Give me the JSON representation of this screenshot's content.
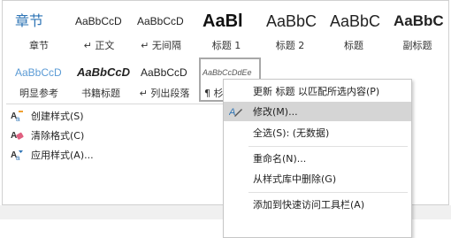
{
  "gallery": {
    "row1": [
      {
        "preview": "章节",
        "caption": "章节"
      },
      {
        "preview": "AaBbCcD",
        "caption": "↵ 正文"
      },
      {
        "preview": "AaBbCcD",
        "caption": "↵ 无间隔"
      },
      {
        "preview": "AaBl",
        "caption": "标题 1"
      },
      {
        "preview": "AaBbC",
        "caption": "标题 2"
      },
      {
        "preview": "AaBbC",
        "caption": "标题"
      },
      {
        "preview": "AaBbC",
        "caption": "副标题"
      }
    ],
    "row2": [
      {
        "preview": "AaBbCcD",
        "caption": "明显参考"
      },
      {
        "preview": "AaBbCcD",
        "caption": "书籍标题"
      },
      {
        "preview": "AaBbCcD",
        "caption": "↵ 列出段落"
      },
      {
        "preview": "AaBbCcDdEe",
        "caption": "¶ 杉"
      }
    ]
  },
  "actions": [
    {
      "label": "创建样式(S)",
      "icon": "create-style-icon"
    },
    {
      "label": "清除格式(C)",
      "icon": "clear-format-icon"
    },
    {
      "label": "应用样式(A)...",
      "icon": "apply-style-icon"
    }
  ],
  "menu": {
    "items": [
      {
        "label": "更新 标题 以匹配所选内容(P)",
        "icon": ""
      },
      {
        "label": "修改(M)...",
        "icon": "modify-icon",
        "hover": true
      },
      {
        "label": "全选(S): (无数据)",
        "icon": ""
      },
      {
        "label": "重命名(N)...",
        "icon": ""
      },
      {
        "label": "从样式库中删除(G)",
        "icon": ""
      },
      {
        "label": "添加到快速访问工具栏(A)",
        "icon": ""
      }
    ]
  },
  "colors": {
    "accent": "#2e74b5",
    "emphasis": "#5b9bd5",
    "menu_hover": "#d5d5d5"
  }
}
